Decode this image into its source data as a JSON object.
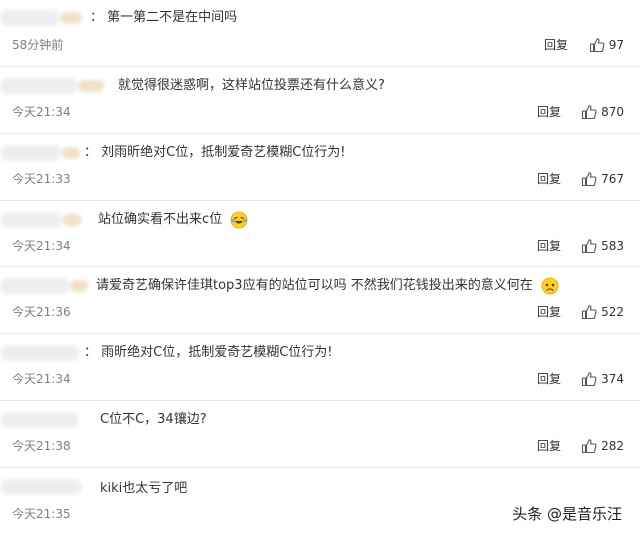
{
  "comments": [
    {
      "text": "：  第一第二不是在中间吗",
      "time": "58分钟前",
      "reply": "回复",
      "likes": "97"
    },
    {
      "text": "就觉得很迷惑啊，这样站位投票还有什么意义?",
      "time": "今天21:34",
      "reply": "回复",
      "likes": "870"
    },
    {
      "text": "：  刘雨昕绝对C位，抵制爱奇艺模糊C位行为!",
      "time": "今天21:33",
      "reply": "回复",
      "likes": "767"
    },
    {
      "text": "站位确实看不出来c位",
      "time": "今天21:34",
      "reply": "回复",
      "likes": "583",
      "emoji": "laughing-tears-emoji"
    },
    {
      "text": "请爱奇艺确保许佳琪top3应有的站位可以吗 不然我们花钱投出来的意义何在",
      "time": "今天21:36",
      "reply": "回复",
      "likes": "522",
      "emoji": "sad-emoji"
    },
    {
      "text": "：  雨昕绝对C位，抵制爱奇艺模糊C位行为!",
      "time": "今天21:34",
      "reply": "回复",
      "likes": "374"
    },
    {
      "text": "C位不C，34镶边?",
      "time": "今天21:38",
      "reply": "回复",
      "likes": "282"
    },
    {
      "text": "kiki也太亏了吧",
      "time": "今天21:35",
      "reply": "",
      "likes": ""
    }
  ],
  "watermark": "头条 @是音乐汪",
  "colors": {
    "text": "#333333",
    "time": "#808080",
    "divider": "#e6e6e6"
  },
  "icons": {
    "like": "thumbs-up-icon"
  }
}
